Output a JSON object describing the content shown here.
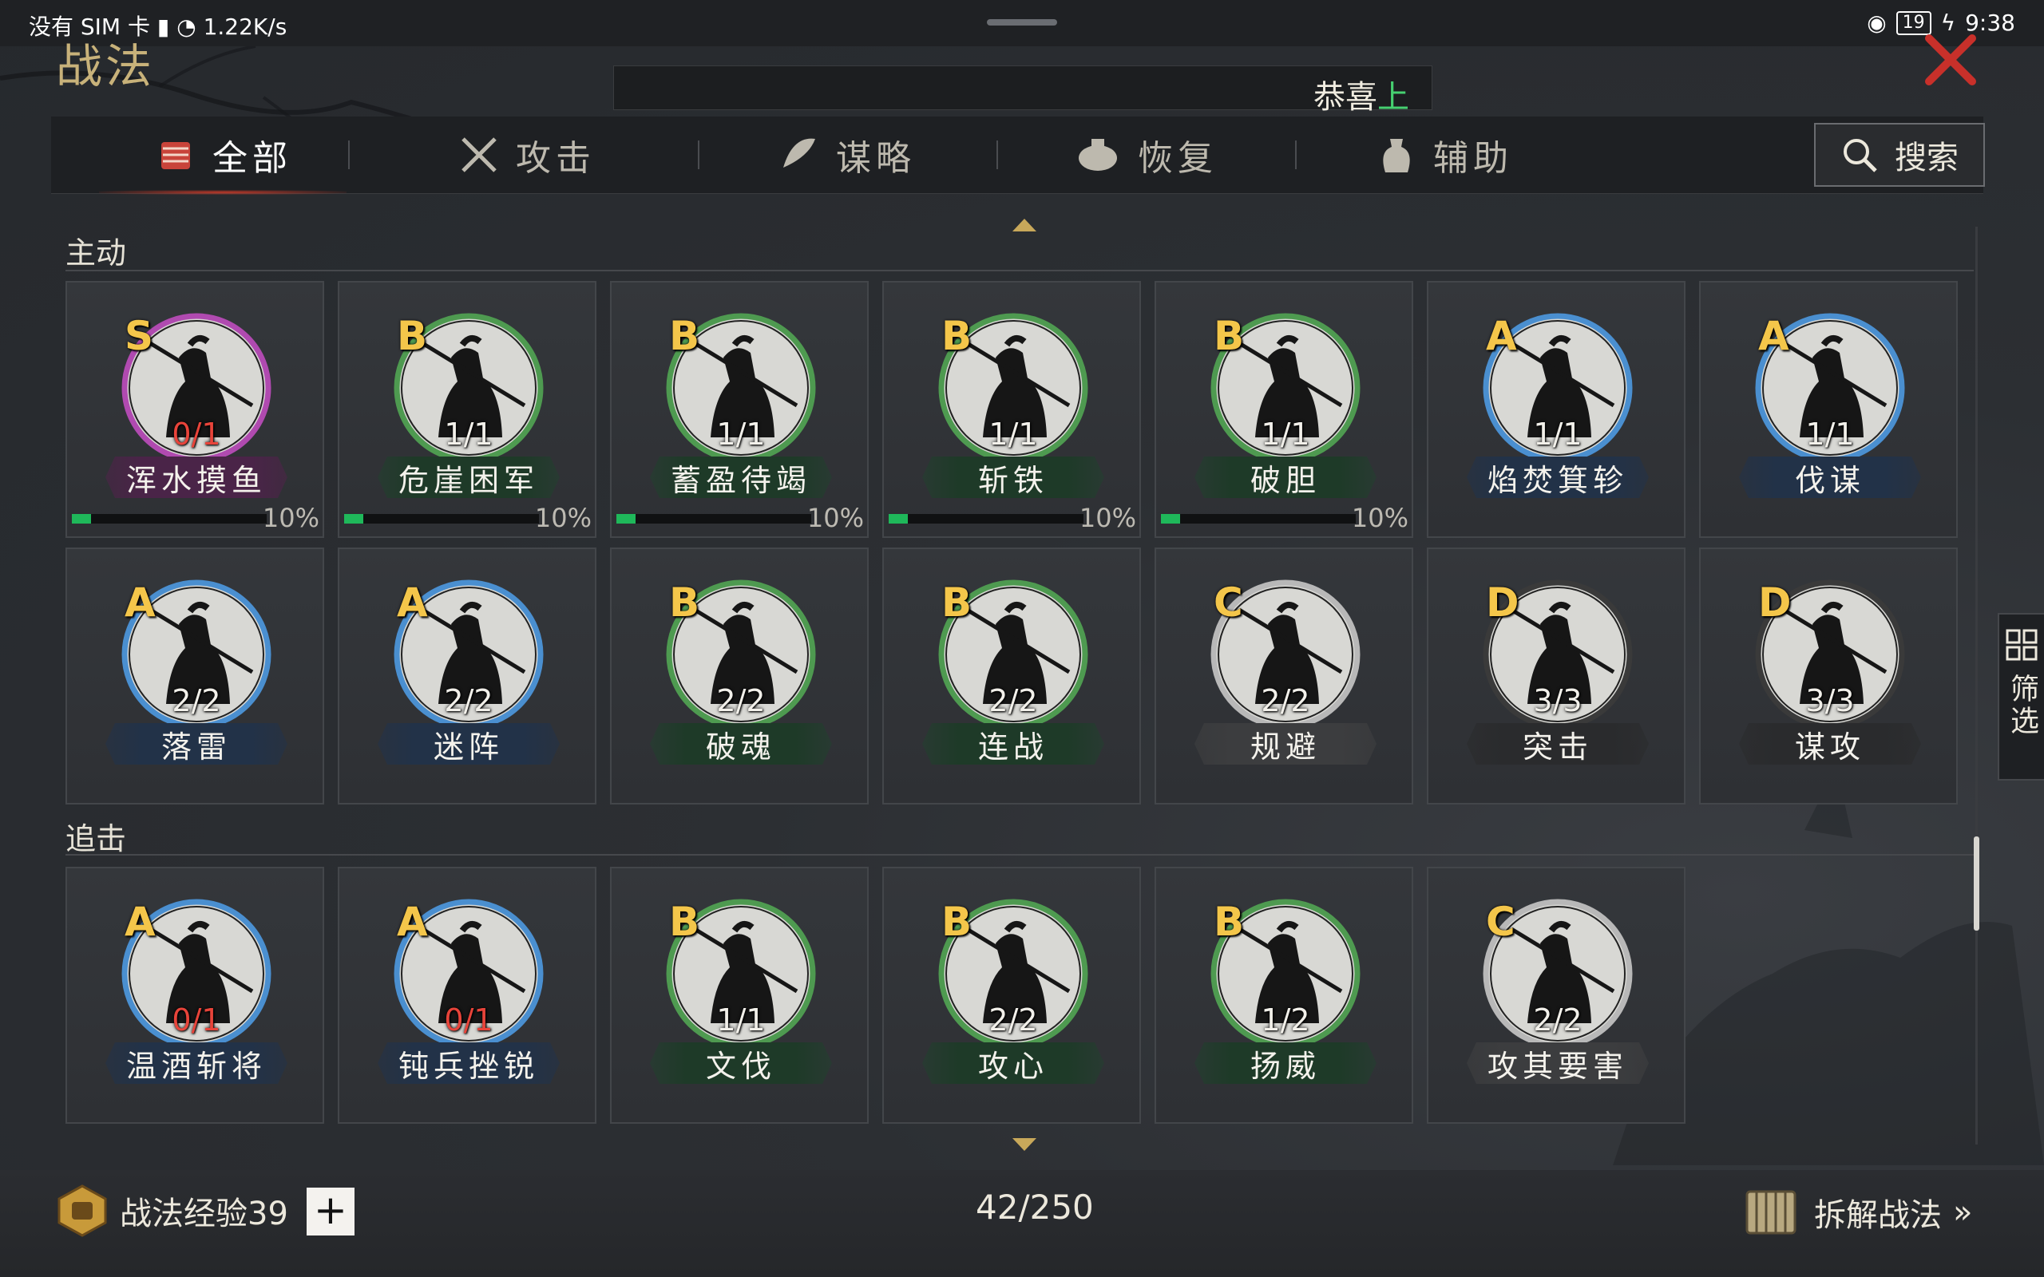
{
  "status_bar": {
    "left_text": "没有 SIM 卡",
    "speed": "1.22K/s",
    "battery": "19",
    "time": "9:38"
  },
  "header": {
    "title": "战法",
    "marquee_prefix": "恭喜",
    "marquee_highlight": "上"
  },
  "tabs": [
    {
      "label": "全部",
      "icon": "all-scroll-icon",
      "active": true
    },
    {
      "label": "攻击",
      "icon": "crossed-swords-icon",
      "active": false
    },
    {
      "label": "谋略",
      "icon": "feather-fan-icon",
      "active": false
    },
    {
      "label": "恢复",
      "icon": "medicine-pot-icon",
      "active": false
    },
    {
      "label": "辅助",
      "icon": "pouch-icon",
      "active": false
    }
  ],
  "search_label": "搜索",
  "filter_label": "筛选",
  "sections": {
    "active": {
      "title": "主动",
      "cards": [
        {
          "grade": "S",
          "count": "0/1",
          "count_red": true,
          "name": "浑水摸鱼",
          "progress": 10,
          "progress_label": "10%"
        },
        {
          "grade": "B",
          "count": "1/1",
          "count_red": false,
          "name": "危崖困军",
          "progress": 10,
          "progress_label": "10%"
        },
        {
          "grade": "B",
          "count": "1/1",
          "count_red": false,
          "name": "蓄盈待竭",
          "progress": 10,
          "progress_label": "10%"
        },
        {
          "grade": "B",
          "count": "1/1",
          "count_red": false,
          "name": "斩铁",
          "progress": 10,
          "progress_label": "10%"
        },
        {
          "grade": "B",
          "count": "1/1",
          "count_red": false,
          "name": "破胆",
          "progress": 10,
          "progress_label": "10%"
        },
        {
          "grade": "A",
          "count": "1/1",
          "count_red": false,
          "name": "焰焚箕轸"
        },
        {
          "grade": "A",
          "count": "1/1",
          "count_red": false,
          "name": "伐谋"
        },
        {
          "grade": "A",
          "count": "2/2",
          "count_red": false,
          "name": "落雷"
        },
        {
          "grade": "A",
          "count": "2/2",
          "count_red": false,
          "name": "迷阵"
        },
        {
          "grade": "B",
          "count": "2/2",
          "count_red": false,
          "name": "破魂"
        },
        {
          "grade": "B",
          "count": "2/2",
          "count_red": false,
          "name": "连战"
        },
        {
          "grade": "C",
          "count": "2/2",
          "count_red": false,
          "name": "规避"
        },
        {
          "grade": "D",
          "count": "3/3",
          "count_red": false,
          "name": "突击"
        },
        {
          "grade": "D",
          "count": "3/3",
          "count_red": false,
          "name": "谋攻"
        }
      ]
    },
    "pursuit": {
      "title": "追击",
      "cards": [
        {
          "grade": "A",
          "count": "0/1",
          "count_red": true,
          "name": "温酒斩将"
        },
        {
          "grade": "A",
          "count": "0/1",
          "count_red": true,
          "name": "钝兵挫锐"
        },
        {
          "grade": "B",
          "count": "1/1",
          "count_red": false,
          "name": "文伐"
        },
        {
          "grade": "B",
          "count": "2/2",
          "count_red": false,
          "name": "攻心"
        },
        {
          "grade": "B",
          "count": "1/2",
          "count_red": false,
          "name": "扬威"
        },
        {
          "grade": "C",
          "count": "2/2",
          "count_red": false,
          "name": "攻其要害"
        }
      ]
    }
  },
  "grade_colors": {
    "S": "#b04ab0",
    "A": "#4a8fd0",
    "B": "#4e9a50",
    "C": "#b8b8b8",
    "D": "#3a3a3a"
  },
  "footer": {
    "exp_label": "战法经验39",
    "plus": "+",
    "page_count": "42/250",
    "decompose_label": "拆解战法"
  }
}
